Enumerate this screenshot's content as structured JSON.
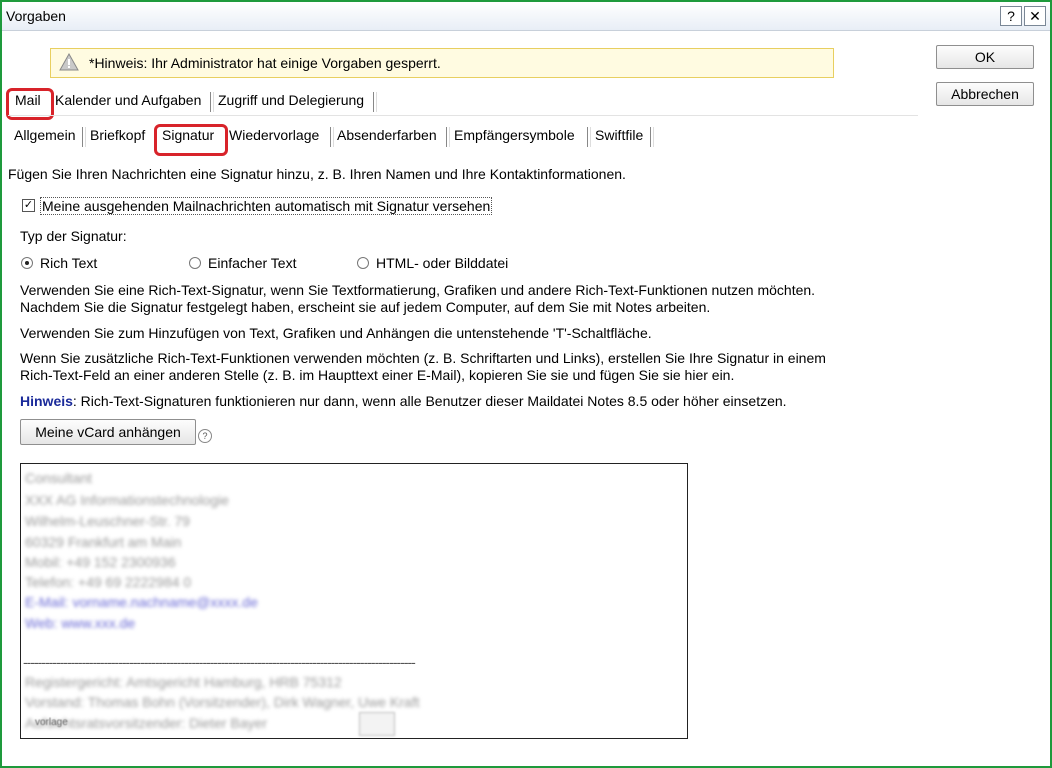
{
  "window": {
    "title": "Vorgaben",
    "help_btn": "?",
    "close_btn": "✕"
  },
  "actions": {
    "ok": "OK",
    "cancel": "Abbrechen"
  },
  "notice": {
    "text": "*Hinweis: Ihr Administrator hat einige Vorgaben gesperrt."
  },
  "tabs_main": [
    "Mail",
    "Kalender und Aufgaben",
    "Zugriff und Delegierung"
  ],
  "tabs_sub": [
    "Allgemein",
    "Briefkopf",
    "Signatur",
    "Wiedervorlage",
    "Absenderfarben",
    "Empfängersymbole",
    "Swiftfile"
  ],
  "content": {
    "intro": "Fügen Sie Ihren Nachrichten eine Signatur hinzu, z. B. Ihren Namen und Ihre Kontaktinformationen.",
    "auto_signature_label": "Meine ausgehenden Mailnachrichten automatisch mit Signatur versehen",
    "auto_signature_checked": true,
    "type_label": "Typ der Signatur:",
    "types": [
      "Rich Text",
      "Einfacher Text",
      "HTML- oder Bilddatei"
    ],
    "selected_type": "Rich Text",
    "para1_line1": "Verwenden Sie eine Rich-Text-Signatur, wenn Sie Textformatierung, Grafiken und andere Rich-Text-Funktionen nutzen möchten.",
    "para1_line2": "Nachdem Sie die Signatur festgelegt haben, erscheint sie auf jedem Computer, auf dem Sie mit Notes arbeiten.",
    "para2": "Verwenden Sie zum Hinzufügen von Text, Grafiken und Anhängen die untenstehende 'T'-Schaltfläche.",
    "para3_line1": "Wenn Sie zusätzliche Rich-Text-Funktionen verwenden möchten (z. B. Schriftarten und Links), erstellen Sie Ihre Signatur in einem",
    "para3_line2": "Rich-Text-Feld an einer anderen Stelle (z. B. im Haupttext einer E-Mail), kopieren Sie sie und fügen Sie sie hier ein.",
    "note_label": "Hinweis",
    "note_text": ": Rich-Text-Signaturen funktionieren nur dann, wenn alle Benutzer dieser Maildatei Notes 8.5 oder höher einsetzen.",
    "vcard_button": "Meine vCard anhängen",
    "help_icon": "?"
  },
  "signature_preview": {
    "lines": [
      "Consultant",
      "XXX AG Informationstechnologie",
      "Wilhelm-Leuschner-Str. 79",
      "60329 Frankfurt am Main",
      "Mobil: +49 152 2300936",
      "Telefon: +49 69 2222984 0",
      "E-Mail: vorname.nachname@xxxx.de",
      "Web: www.xxx.de"
    ],
    "separator": "-----------------------------------------------------------------------------------------------------------",
    "footer_lines": [
      "Registergericht: Amtsgericht Hamburg, HRB 75312",
      "Vorstand: Thomas Bohn (Vorsitzender), Dirk Wagner, Uwe Kraft",
      "Aufsichtsratsvorsitzender: Dieter Bayer"
    ],
    "watermark": "vorlage"
  }
}
